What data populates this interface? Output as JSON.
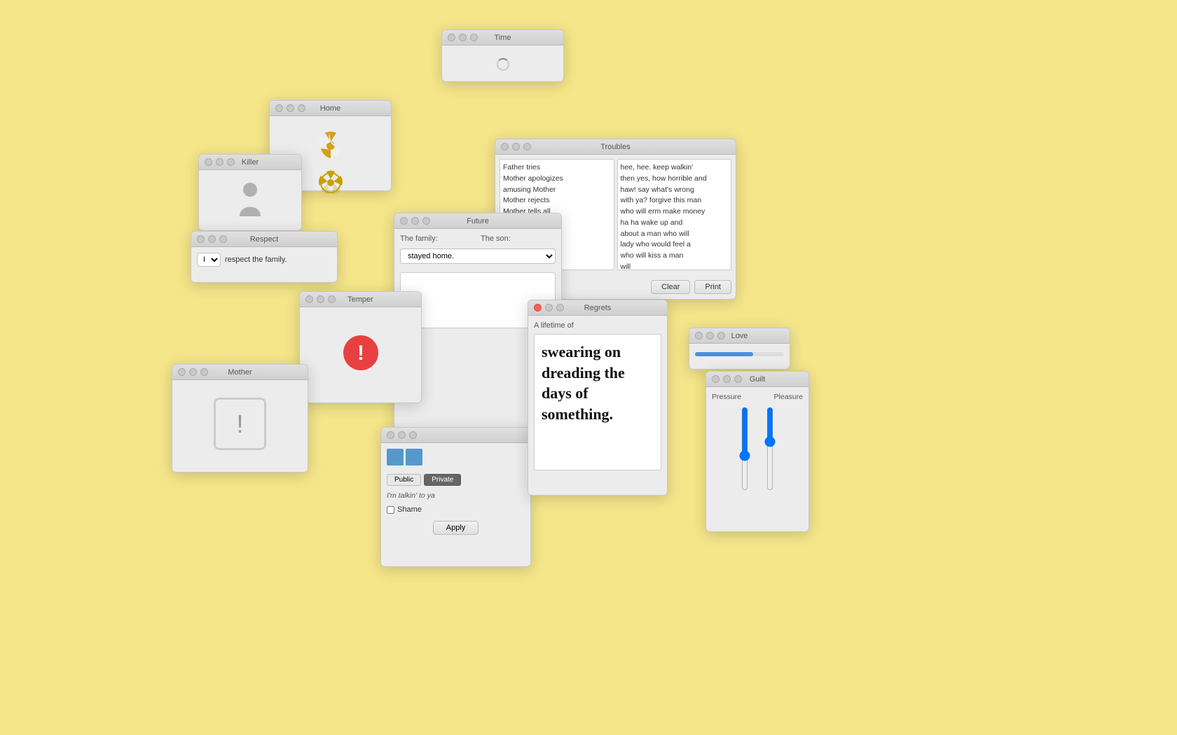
{
  "background": "#f5e68a",
  "windows": {
    "time": {
      "title": "Time",
      "has_spinner": true
    },
    "home": {
      "title": "Home"
    },
    "killer": {
      "title": "Killer"
    },
    "respect": {
      "title": "Respect",
      "select_value": "I",
      "label": "respect the family."
    },
    "troubles": {
      "title": "Troubles",
      "left_text": "Father tries\nMother apologizes\namusing Mother\nMother rejects\nMother tells all\nselfish Mother",
      "right_text": "hee, hee. keep walkin'\nthen yes, how horrible and\nhaw! say what's wrong\nwith ya? forgive this man\nwho will erm make money\nha ha wake up and\nabout a man who will\nlady who would feel a\nwho will kiss a man\nwill",
      "btn_clear": "Clear",
      "btn_print": "Print"
    },
    "future": {
      "title": "Future",
      "label_family": "The family:",
      "label_son": "The son:",
      "select_value": "stayed home."
    },
    "temper": {
      "title": "Temper"
    },
    "mother": {
      "title": "Mother"
    },
    "regrets": {
      "title": "Regrets",
      "subtitle": "A lifetime of",
      "body_text": "swearing on\ndreading the\ndays of\nsomething."
    },
    "love": {
      "title": "Love",
      "bar_width": "65%"
    },
    "guilt": {
      "title": "Guilt",
      "label_pressure": "Pressure",
      "label_pleasure": "Pleasure",
      "pressure_value": 60,
      "pleasure_value": 40
    },
    "public_area": {
      "btn_public": "Public",
      "btn_private": "Private",
      "talking_text": "I'm talkin' to ya",
      "shame_label": "Shame",
      "apply_label": "Apply"
    }
  }
}
